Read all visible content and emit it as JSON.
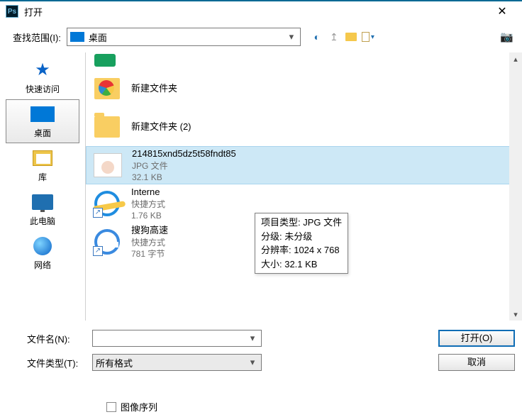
{
  "title": "打开",
  "look_in_label": "查找范围(I):",
  "look_in_value": "桌面",
  "sidebar": [
    {
      "label": "快速访问"
    },
    {
      "label": "桌面"
    },
    {
      "label": "库"
    },
    {
      "label": "此电脑"
    },
    {
      "label": "网络"
    }
  ],
  "files": [
    {
      "name": "新建文件夹"
    },
    {
      "name": "新建文件夹 (2)"
    },
    {
      "name": "214815xnd5dz5t58fndt85",
      "type": "JPG 文件",
      "size": "32.1 KB"
    },
    {
      "name": "Interne",
      "type": "快捷方式",
      "size": "1.76 KB"
    },
    {
      "name": "搜狗高速",
      "type": "快捷方式",
      "size": "781 字节"
    }
  ],
  "tooltip": {
    "l1": "项目类型: JPG 文件",
    "l2": "分级: 未分级",
    "l3": "分辨率: 1024 x 768",
    "l4": "大小: 32.1 KB"
  },
  "filename_label": "文件名(N):",
  "filename_value": "",
  "filetype_label": "文件类型(T):",
  "filetype_value": "所有格式",
  "open_btn": "打开(O)",
  "cancel_btn": "取消",
  "image_sequence": "图像序列"
}
